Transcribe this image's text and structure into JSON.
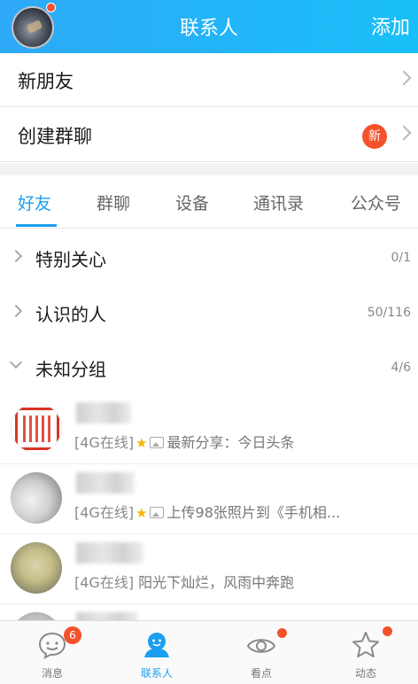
{
  "header": {
    "title": "联系人",
    "add_label": "添加"
  },
  "menu": {
    "new_friends": "新朋友",
    "create_group": "创建群聊",
    "new_badge": "新"
  },
  "tabs": [
    "好友",
    "群聊",
    "设备",
    "通讯录",
    "公众号"
  ],
  "groups": [
    {
      "label": "特别关心",
      "count": "0/1",
      "expanded": false
    },
    {
      "label": "认识的人",
      "count": "50/116",
      "expanded": false
    },
    {
      "label": "未知分组",
      "count": "4/6",
      "expanded": true
    }
  ],
  "contacts": [
    {
      "status": "[4G在线]",
      "text": "最新分享：今日头条"
    },
    {
      "status": "[4G在线]",
      "text": "上传98张照片到《手机相..."
    },
    {
      "status": "[4G在线]",
      "text": "阳光下灿烂，风雨中奔跑"
    }
  ],
  "tabbar": {
    "items": [
      {
        "label": "消息",
        "badge": "6"
      },
      {
        "label": "联系人"
      },
      {
        "label": "看点"
      },
      {
        "label": "动态"
      }
    ]
  },
  "colors": {
    "accent": "#1a9ff0",
    "badge": "#f4522b",
    "header": "#2ea9f7"
  }
}
